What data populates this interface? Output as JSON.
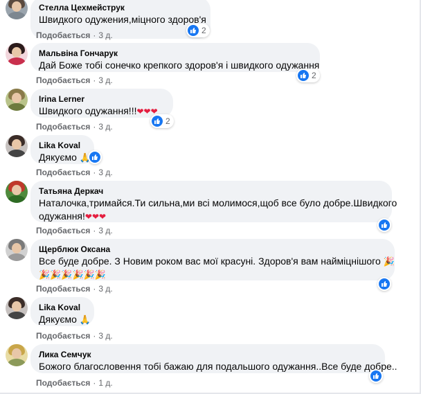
{
  "ui": {
    "like_label": "Подобається",
    "separator": "·"
  },
  "colors": {
    "reaction_blue": "#1877f2",
    "bubble_bg": "#f0f2f5",
    "meta_gray": "#65676b",
    "heart_red": "#e41e3f"
  },
  "comments": [
    {
      "author": "Стелла Цехмейструк",
      "text": "Швидкого одужения,міцного здоров'я",
      "time": "3 д.",
      "reactions": "2",
      "avatar_icon": "user-avatar-icon"
    },
    {
      "author": "Мальвіна Гончарук",
      "text": "Дай Боже тобі сонечко крепкого здоров'я і швидкого одужання",
      "time": "3 д.",
      "reactions": "2",
      "avatar_icon": "user-avatar-icon"
    },
    {
      "author": "Irina Lerner",
      "text": "Швидкого одужання!!!",
      "hearts": "❤❤❤",
      "time": "3 д.",
      "reactions": "2",
      "avatar_icon": "user-avatar-icon"
    },
    {
      "author": "Lika Koval",
      "text": "Дякуємо",
      "time": "3 д.",
      "avatar_icon": "user-avatar-icon"
    },
    {
      "author": "Татьяна Деркач",
      "text_line1": "Наталочка,тримайся.Ти сильна,ми всі молимося,щоб все було добре.Швидкого",
      "text_line2": "одужання!",
      "hearts": "❤❤❤",
      "time": "3 д.",
      "avatar_icon": "user-avatar-icon"
    },
    {
      "author": "Щерблюк Оксана",
      "text_line1": "Все буде добре. З Новим роком вас мої красуні. Здоров'я вам найміцнішого",
      "time": "3 д.",
      "avatar_icon": "user-avatar-icon"
    },
    {
      "author": "Lika Koval",
      "text": "Дякуємо",
      "time": "3 д.",
      "avatar_icon": "user-avatar-icon"
    },
    {
      "author": "Лика Семчук",
      "text": "Божого благословення тобі бажаю для подальшого одужання..Все буде добре..",
      "time": "1 д.",
      "avatar_icon": "user-avatar-icon"
    }
  ]
}
